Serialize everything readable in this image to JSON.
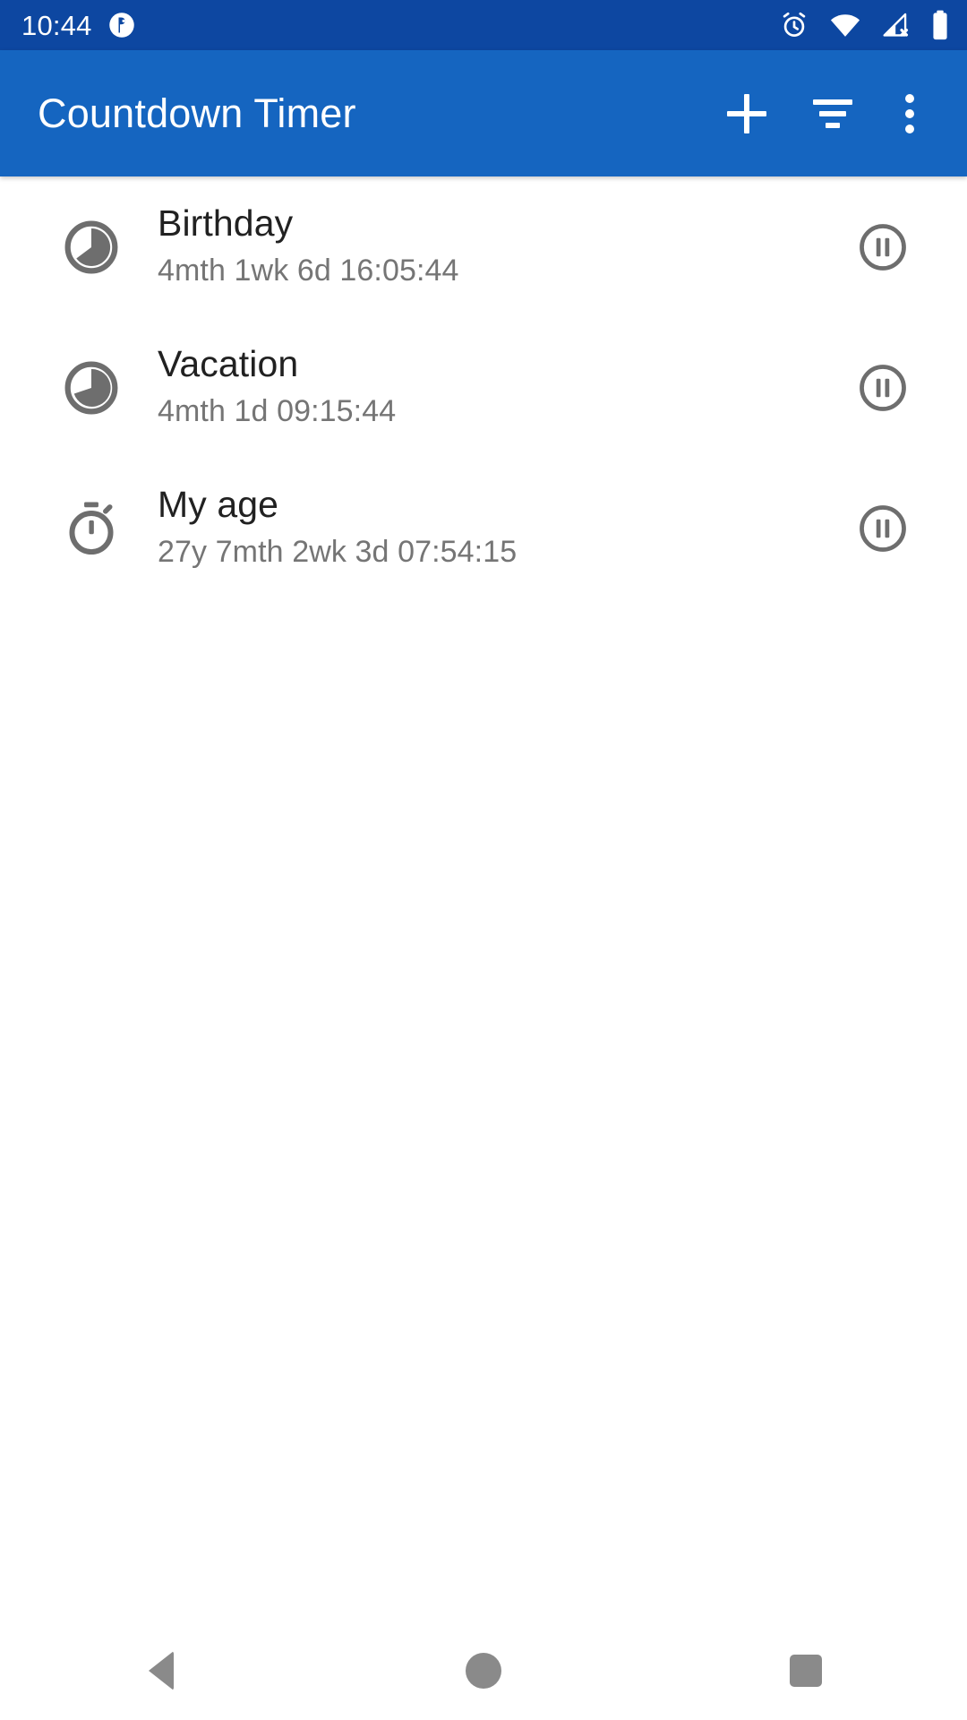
{
  "status_bar": {
    "clock": "10:44",
    "background_color": "#0d47a1",
    "icons": [
      {
        "name": "app-notification-icon",
        "label": "notification"
      },
      {
        "name": "alarm-icon",
        "label": "alarm set"
      },
      {
        "name": "wifi-icon",
        "label": "wifi connected"
      },
      {
        "name": "cellular-off-icon",
        "label": "no cellular signal"
      },
      {
        "name": "battery-icon",
        "label": "battery full"
      }
    ]
  },
  "app_bar": {
    "title": "Countdown Timer",
    "background_color": "#1565c0",
    "actions": [
      {
        "name": "add-timer-button",
        "icon": "plus-icon",
        "label": "Add"
      },
      {
        "name": "sort-button",
        "icon": "filter-sort-icon",
        "label": "Sort"
      },
      {
        "name": "overflow-menu-button",
        "icon": "more-vert-icon",
        "label": "More options"
      }
    ]
  },
  "timers": [
    {
      "title": "Birthday",
      "remaining": "4mth 1wk 6d 16:05:44",
      "lead_icon": "pie-progress-icon",
      "progress": 0.62,
      "action_icon": "pause-circle-icon",
      "action_label": "Pause"
    },
    {
      "title": "Vacation",
      "remaining": "4mth 1d 09:15:44",
      "lead_icon": "pie-progress-icon",
      "progress": 0.55,
      "action_icon": "pause-circle-icon",
      "action_label": "Pause"
    },
    {
      "title": "My age",
      "remaining": "27y 7mth 2wk 3d 07:54:15",
      "lead_icon": "stopwatch-icon",
      "progress": null,
      "action_icon": "pause-circle-icon",
      "action_label": "Pause"
    }
  ],
  "navigation_bar": {
    "buttons": [
      {
        "name": "nav-back-button",
        "label": "Back"
      },
      {
        "name": "nav-home-button",
        "label": "Home"
      },
      {
        "name": "nav-recents-button",
        "label": "Recents"
      }
    ]
  },
  "colors": {
    "status_bar": "#0d47a1",
    "app_bar": "#1565c0",
    "title_text": "#212121",
    "subtitle_text": "#757575",
    "icon_grey": "#6e6e6e",
    "nav_grey": "#8a8a8a"
  }
}
